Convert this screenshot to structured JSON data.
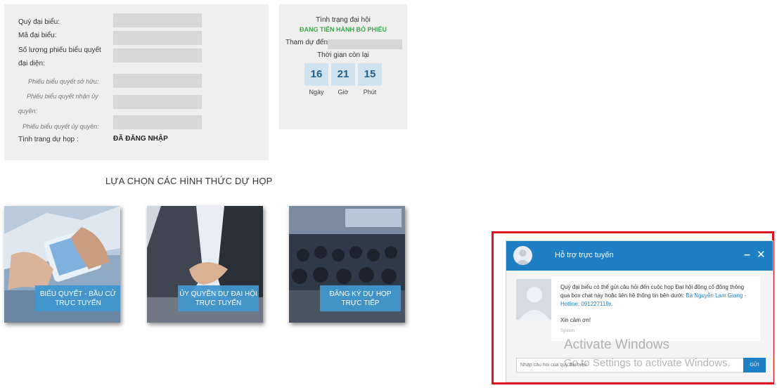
{
  "info": {
    "delegate_name_label": "Quý đại biểu:",
    "delegate_code_label": "Mã đại biểu:",
    "votes_count_label_1": "Số lượng phiếu biểu quyết",
    "votes_count_label_2": "đại diện:",
    "owned_votes_label": "Phiếu biểu quyết sở hữu:",
    "received_votes_label_1": "Phiếu biểu quyết nhận ủy",
    "received_votes_label_2": "quyền:",
    "delegated_votes_label": "Phiếu biểu quyết ủy quyền:",
    "attendance_status_label": "Tình trang dự họp :",
    "attendance_status_value": "ĐÃ ĐĂNG NHẬP"
  },
  "meeting": {
    "status_title": "Tình trạng đại hội",
    "status_value": "ĐANG TIẾN HÀNH BỎ PHIẾU",
    "attend_label": "Tham dự đến:",
    "remaining_label": "Thời gian còn lại",
    "countdown": [
      {
        "value": "16",
        "unit": "Ngày"
      },
      {
        "value": "21",
        "unit": "Giờ"
      },
      {
        "value": "15",
        "unit": "Phút"
      }
    ]
  },
  "options": {
    "title": "LỰA CHỌN CÁC HÌNH THỨC DỰ HỌP",
    "cards": [
      {
        "line1": "BIỂU QUYẾT - BẦU CỬ",
        "line2": "TRỰC TUYẾN"
      },
      {
        "line1": "ỦY QUYỀN DỰ ĐẠI HỘI",
        "line2": "TRỰC TUYẾN"
      },
      {
        "line1": "ĐĂNG KÝ DỰ HỌP",
        "line2": "TRỰC TIẾP"
      }
    ]
  },
  "chat": {
    "title": "Hỗ trợ trực tuyến",
    "minimize": "–",
    "close": "✕",
    "message_part1": "Quý đại biểu có thể gửi câu hỏi đến cuộc họp Đại hội đồng cổ đông thông qua box chat này hoặc liên hệ thông tin bên dưới: ",
    "message_contact": "Bà Nguyễn Lam Giang - Hotline: 091227119x.",
    "thanks": "Xin cảm ơn!",
    "sender": "System",
    "input_placeholder": "Nhập câu hỏi của quý đại biểu",
    "send_label": "GỬI"
  },
  "watermark": {
    "line1": "Activate Windows",
    "line2": "Go to Settings to activate Windows."
  },
  "colors": {
    "accent": "#1e7fc4",
    "status_green": "#3aa84a",
    "panel_bg": "#efefef",
    "highlight_border": "#e0141c"
  }
}
